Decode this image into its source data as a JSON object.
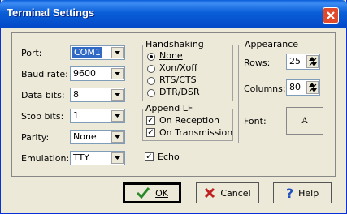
{
  "window": {
    "title": "Terminal Settings"
  },
  "background_fragments": [
    "1",
    "1",
    "1",
    "1",
    "d",
    "4"
  ],
  "port": {
    "label": "Port:",
    "value": "COM1"
  },
  "baud_rate": {
    "label": "Baud rate:",
    "value": "9600"
  },
  "data_bits": {
    "label": "Data bits:",
    "value": "8"
  },
  "stop_bits": {
    "label": "Stop bits:",
    "value": "1"
  },
  "parity": {
    "label": "Parity:",
    "value": "None"
  },
  "emulation": {
    "label": "Emulation:",
    "value": "TTY"
  },
  "handshaking": {
    "title": "Handshaking",
    "options": [
      "None",
      "Xon/Xoff",
      "RTS/CTS",
      "DTR/DSR"
    ],
    "selected": "None"
  },
  "append_lf": {
    "title": "Append LF",
    "on_reception": {
      "label": "On Reception",
      "checked": true
    },
    "on_transmission": {
      "label": "On Transmission",
      "checked": true
    }
  },
  "echo": {
    "label": "Echo",
    "checked": true
  },
  "appearance": {
    "title": "Appearance",
    "rows": {
      "label": "Rows:",
      "value": "25"
    },
    "columns": {
      "label": "Columns:",
      "value": "80"
    },
    "font": {
      "label": "Font:",
      "button_label": "A"
    }
  },
  "buttons": {
    "ok": "OK",
    "cancel": "Cancel",
    "help": "Help"
  },
  "colors": {
    "title_bar": "#0a5fd8",
    "close_button": "#e04a2a",
    "ok_check": "#2a8a2a",
    "cancel_x": "#c02020",
    "help_mark": "#2050c0"
  }
}
